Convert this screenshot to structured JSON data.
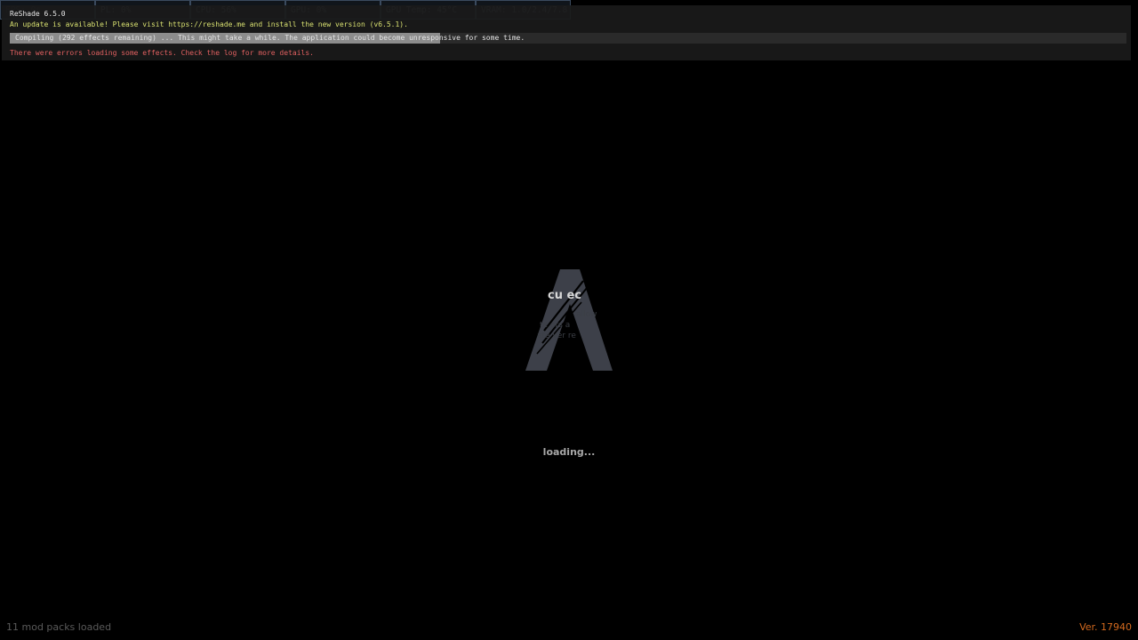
{
  "stats": [
    {
      "label": "FPS: 0s"
    },
    {
      "label": "PL: 0%"
    },
    {
      "label": "CPU: 56%"
    },
    {
      "label": "GPU: 0%"
    },
    {
      "label": "GPU Temp: 45°C"
    },
    {
      "label": "VRAM: 1.0/2.4/7.8 GB"
    }
  ],
  "reshade": {
    "title": "ReShade 6.5.0",
    "update_message": "An update is available! Please visit https://reshade.me and install the new version (v6.5.1).",
    "compile_progress": 0.385,
    "compile_message": "Compiling (292 effects remaining) ... This might take a while. The application could become unresponsive for some time.",
    "error_message": "There were errors loading some effects. Check the log for more details."
  },
  "splash": {
    "ghost_heading": "cu  ec",
    "ghost_lines": [
      "allow",
      "te  ers a",
      "ate    ver re"
    ],
    "loading_text": "loading..."
  },
  "footer": {
    "mod_packs": "11 mod packs loaded",
    "version": "Ver. 17940"
  },
  "colors": {
    "update": "#d8e070",
    "error": "#e06060",
    "version": "#d2691e",
    "logo": "#3d4049"
  }
}
